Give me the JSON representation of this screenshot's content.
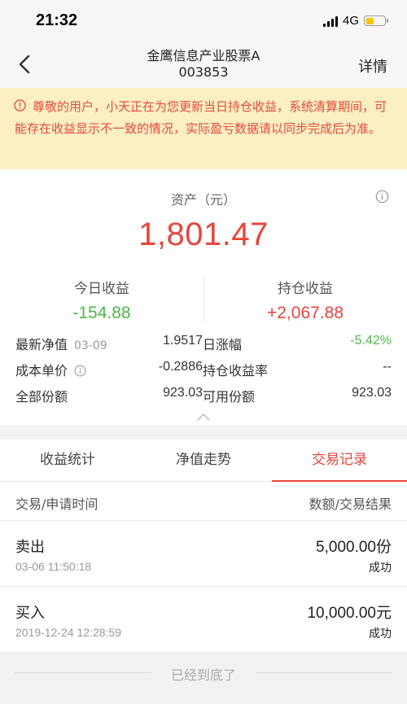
{
  "status_bar": {
    "time": "21:32",
    "network": "4G"
  },
  "nav": {
    "title": "金鹰信息产业股票A",
    "code": "003853",
    "detail_label": "详情"
  },
  "notice": {
    "text": "尊敬的用户，小天正在为您更新当日持仓收益，系统清算期间，可能存在收益显示不一致的情况，实际盈亏数据请以同步完成后为准。"
  },
  "asset": {
    "label": "资产（元）",
    "value": "1,801.47",
    "today_income_label": "今日收益",
    "today_income_value": "-154.88",
    "holding_income_label": "持仓收益",
    "holding_income_value": "+2,067.88"
  },
  "metrics": {
    "nav_label": "最新净值",
    "nav_date": "03-09",
    "nav_value": "1.9517",
    "change_label": "日涨幅",
    "change_value": "-5.42%",
    "cost_label": "成本单价",
    "cost_value": "-0.2886",
    "holding_rate_label": "持仓收益率",
    "holding_rate_value": "--",
    "total_shares_label": "全部份额",
    "total_shares_value": "923.03",
    "available_shares_label": "可用份额",
    "available_shares_value": "923.03"
  },
  "tabs": [
    {
      "label": "收益统计",
      "active": false
    },
    {
      "label": "净值走势",
      "active": false
    },
    {
      "label": "交易记录",
      "active": true
    }
  ],
  "list_header": {
    "left": "交易/申请时间",
    "right": "数额/交易结果"
  },
  "records": [
    {
      "type": "卖出",
      "time": "03-06 11:50:18",
      "amount": "5,000.00份",
      "result": "成功"
    },
    {
      "type": "买入",
      "time": "2019-12-24 12:28:59",
      "amount": "10,000.00元",
      "result": "成功"
    }
  ],
  "footer": {
    "text": "已经到底了"
  },
  "colors": {
    "red": "#e8453c",
    "green": "#4cb848",
    "notice_bg": "#fbefc3",
    "battery": "#f7c800"
  }
}
